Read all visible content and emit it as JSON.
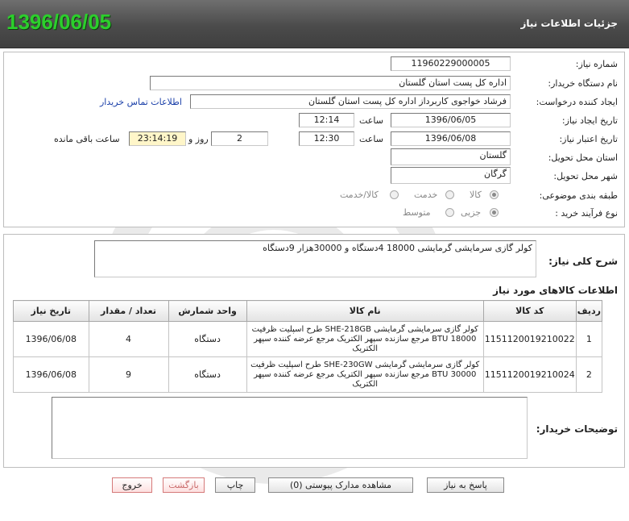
{
  "header": {
    "title": "جزئیات اطلاعات نیاز",
    "date": "1396/06/05"
  },
  "form": {
    "need_number": {
      "label": "شماره نیاز:",
      "value": "1196022900000​5"
    },
    "buyer_org": {
      "label": "نام دستگاه خریدار:",
      "value": "اداره کل پست استان گلستان"
    },
    "requester": {
      "label": "ایجاد کننده درخواست:",
      "value": "فرشاد خواجوی کاربرداز اداره کل پست استان گلستان",
      "contact_link": "اطلاعات تماس خریدار"
    },
    "create_date": {
      "label": "تاریخ ایجاد نیاز:",
      "date": "1396/06/05",
      "time_label": "ساعت",
      "time": "12:14"
    },
    "valid_date": {
      "label": "تاریخ اعتبار نیاز:",
      "date": "1396/06/08",
      "time_label": "ساعت",
      "time": "12:30",
      "days": "2",
      "days_label": "روز و",
      "remaining": "23:14:19",
      "remaining_label": "ساعت باقی مانده"
    },
    "province": {
      "label": "استان محل تحویل:",
      "value": "گلستان"
    },
    "city": {
      "label": "شهر محل تحویل:",
      "value": "گرگان"
    },
    "category": {
      "label": "طبقه بندی موضوعی:",
      "options": [
        "کالا",
        "خدمت",
        "کالا/خدمت"
      ],
      "selected": 0
    },
    "process": {
      "label": "نوع فرآیند خرید :",
      "options": [
        "جزیی",
        "متوسط"
      ],
      "selected": 0
    }
  },
  "summary": {
    "label": "شرح کلی نیاز:",
    "value": "کولر گازی سرمایشی گرمایشی 18000 4دستگاه و 30000هزار 9دستگاه"
  },
  "items": {
    "section_title": "اطلاعات کالاهای مورد نیاز",
    "headers": [
      "ردیف",
      "کد کالا",
      "نام کالا",
      "واحد شمارش",
      "تعداد / مقدار",
      "تاریخ نیاز"
    ],
    "rows": [
      {
        "row": "1",
        "code": "1151120019210022",
        "name": "کولر گازی سرمایشی گرمایشی SHE-218GB طرح اسپلیت ظرفیت 18000 BTU مرجع سازنده سپهر الکتریک مرجع عرضه کننده سپهر الکتریک",
        "unit": "دستگاه",
        "qty": "4",
        "date": "1396/06/08"
      },
      {
        "row": "2",
        "code": "1151120019210024",
        "name": "کولر گازی سرمایشی گرمایشی SHE-230GW طرح اسپلیت ظرفیت 30000 BTU مرجع سازنده سپهر الکتریک مرجع عرضه کننده سپهر الکتریک",
        "unit": "دستگاه",
        "qty": "9",
        "date": "1396/06/08"
      }
    ]
  },
  "buyer_notes": {
    "label": "توضیحات خریدار:",
    "value": ""
  },
  "buttons": {
    "reply": "پاسخ به نیاز",
    "attachments": "مشاهده مدارک پیوستی (0)",
    "print": "چاپ",
    "back": "بازگشت",
    "exit": "خروج"
  }
}
